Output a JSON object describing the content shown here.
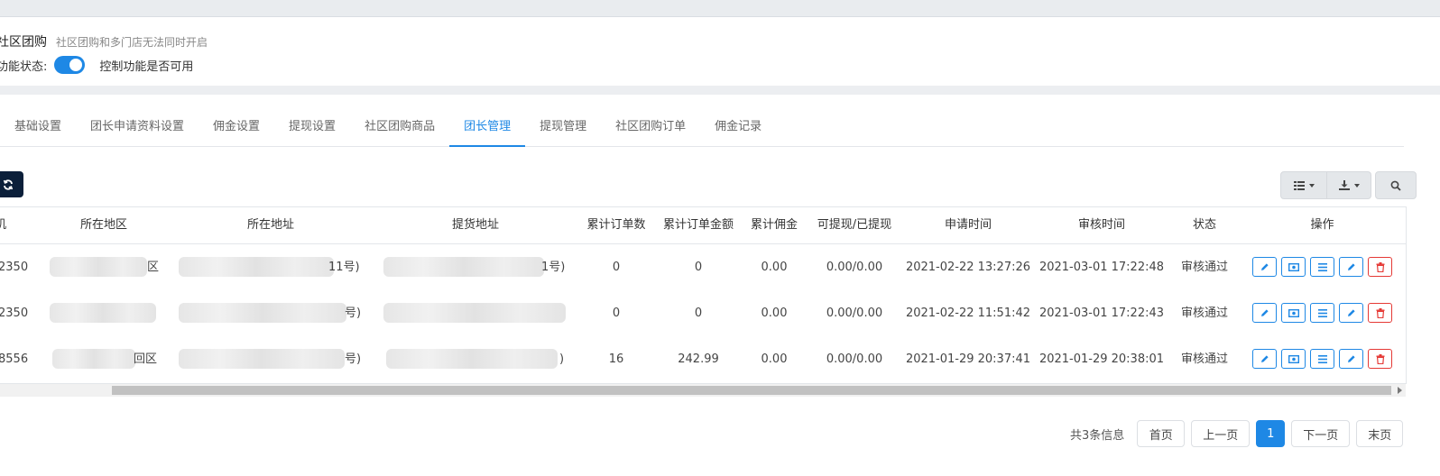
{
  "header": {
    "title": "社区团购",
    "note": "社区团购和多门店无法同时开启",
    "status_label": "功能状态:",
    "status_on": true,
    "status_desc": "控制功能是否可用"
  },
  "tabs": [
    {
      "label": "基础设置",
      "active": false
    },
    {
      "label": "团长申请资料设置",
      "active": false
    },
    {
      "label": "佣金设置",
      "active": false
    },
    {
      "label": "提现设置",
      "active": false
    },
    {
      "label": "社区团购商品",
      "active": false
    },
    {
      "label": "团长管理",
      "active": true
    },
    {
      "label": "提现管理",
      "active": false
    },
    {
      "label": "社区团购订单",
      "active": false
    },
    {
      "label": "佣金记录",
      "active": false
    }
  ],
  "toolbar": {
    "refresh_icon": "refresh-icon",
    "columns_icon": "list-icon",
    "export_icon": "download-icon",
    "search_icon": "search-icon"
  },
  "table": {
    "columns": [
      "机",
      "所在地区",
      "所在地址",
      "提货地址",
      "累计订单数",
      "累计订单金额",
      "累计佣金",
      "可提现/已提现",
      "申请时间",
      "审核时间",
      "状态",
      "操作"
    ],
    "rows": [
      {
        "phone": "2350",
        "region_tail": "区",
        "address_tail": "11号)",
        "pickup_tail": "1号)",
        "orders": "0",
        "amount": "0",
        "commission": "0.00",
        "withdraw": "0.00/0.00",
        "apply_time": "2021-02-22 13:27:26",
        "review_time": "2021-03-01 17:22:48",
        "status": "审核通过"
      },
      {
        "phone": "2350",
        "region_tail": "",
        "address_tail": "号)",
        "pickup_tail": "",
        "orders": "0",
        "amount": "0",
        "commission": "0.00",
        "withdraw": "0.00/0.00",
        "apply_time": "2021-02-22 11:51:42",
        "review_time": "2021-03-01 17:22:43",
        "status": "审核通过"
      },
      {
        "phone": "8556",
        "region_tail": "回区",
        "address_tail": "号)",
        "pickup_tail": ")",
        "orders": "16",
        "amount": "242.99",
        "commission": "0.00",
        "withdraw": "0.00/0.00",
        "apply_time": "2021-01-29 20:37:41",
        "review_time": "2021-01-29 20:38:01",
        "status": "审核通过"
      }
    ],
    "row_actions": [
      "edit-icon",
      "money-icon",
      "list-icon",
      "pencil-icon",
      "trash-icon"
    ]
  },
  "pagination": {
    "info": "共3条信息",
    "first": "首页",
    "prev": "上一页",
    "current": "1",
    "next": "下一页",
    "last": "末页"
  },
  "colors": {
    "accent": "#1e88e5",
    "danger": "#e53935",
    "dark_button": "#0b1f3a"
  }
}
